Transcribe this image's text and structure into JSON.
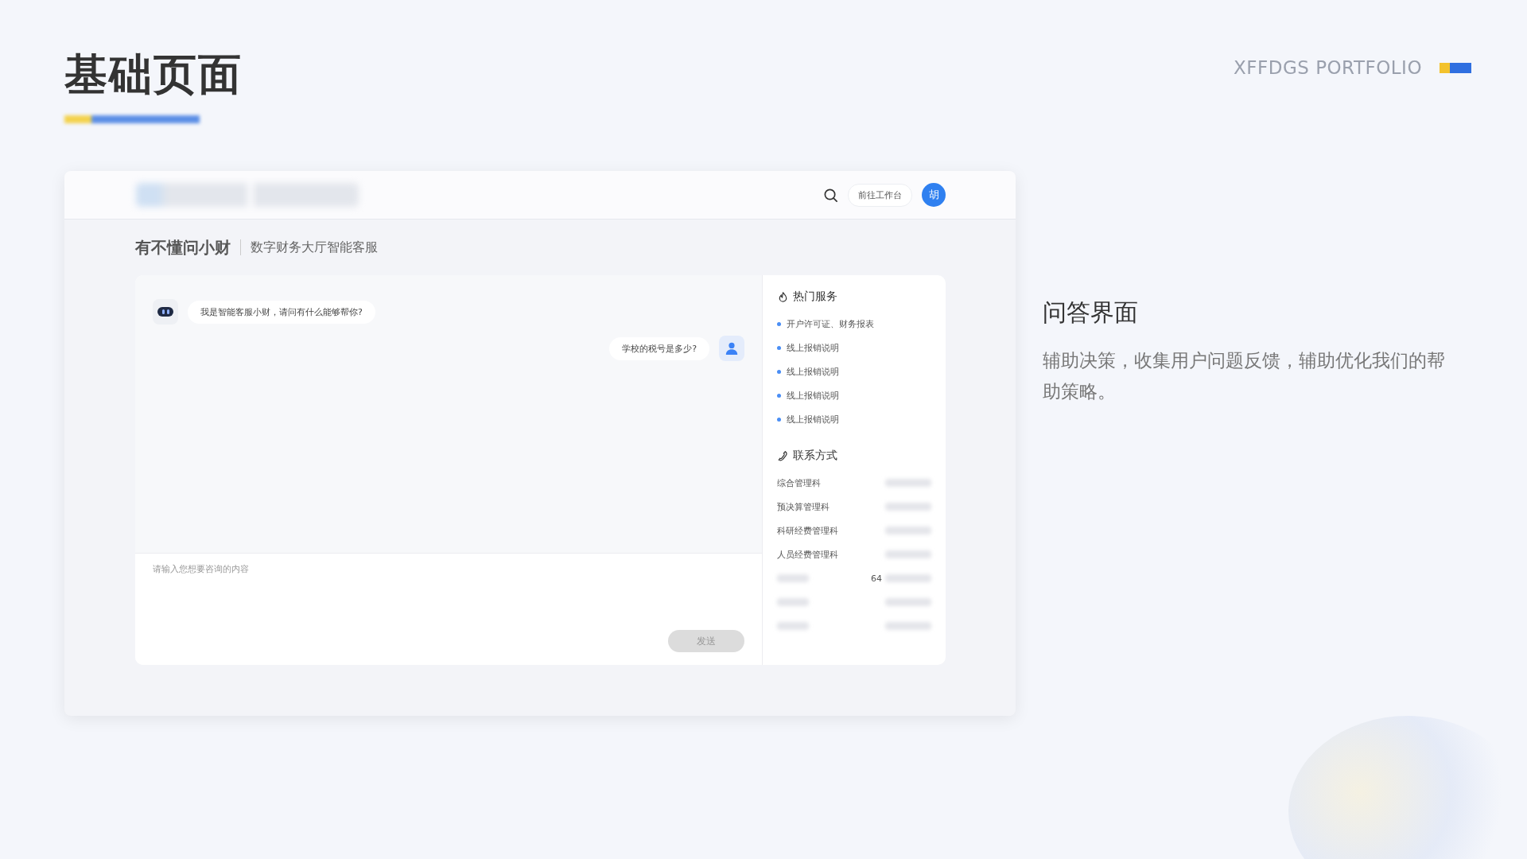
{
  "slide": {
    "title": "基础页面",
    "brand": "XFFDGS PORTFOLIO"
  },
  "mockup": {
    "header": {
      "button": "前往工作台",
      "avatar": "胡"
    },
    "page_title": "有不懂问小财",
    "page_subtitle": "数字财务大厅智能客服",
    "messages": [
      {
        "kind": "bot",
        "text": "我是智能客服小财，请问有什么能够帮你?"
      },
      {
        "kind": "user",
        "text": "学校的税号是多少?"
      }
    ],
    "input": {
      "placeholder": "请输入您想要咨询的内容"
    },
    "send_button": {
      "label": "发送",
      "disabled": true
    },
    "hot_services": {
      "title": "热门服务",
      "items": [
        "开户许可证、财务报表",
        "线上报销说明",
        "线上报销说明",
        "线上报销说明",
        "线上报销说明"
      ]
    },
    "contacts": {
      "title": "联系方式",
      "rows": [
        {
          "name": "综合管理科"
        },
        {
          "name": "预决算管理科"
        },
        {
          "name": "科研经费管理科"
        },
        {
          "name": "人员经费管理科"
        },
        {
          "value": "64"
        },
        {},
        {}
      ]
    }
  },
  "side": {
    "heading": "问答界面",
    "body": "辅助决策，收集用户问题反馈，辅助优化我们的帮助策略。"
  }
}
